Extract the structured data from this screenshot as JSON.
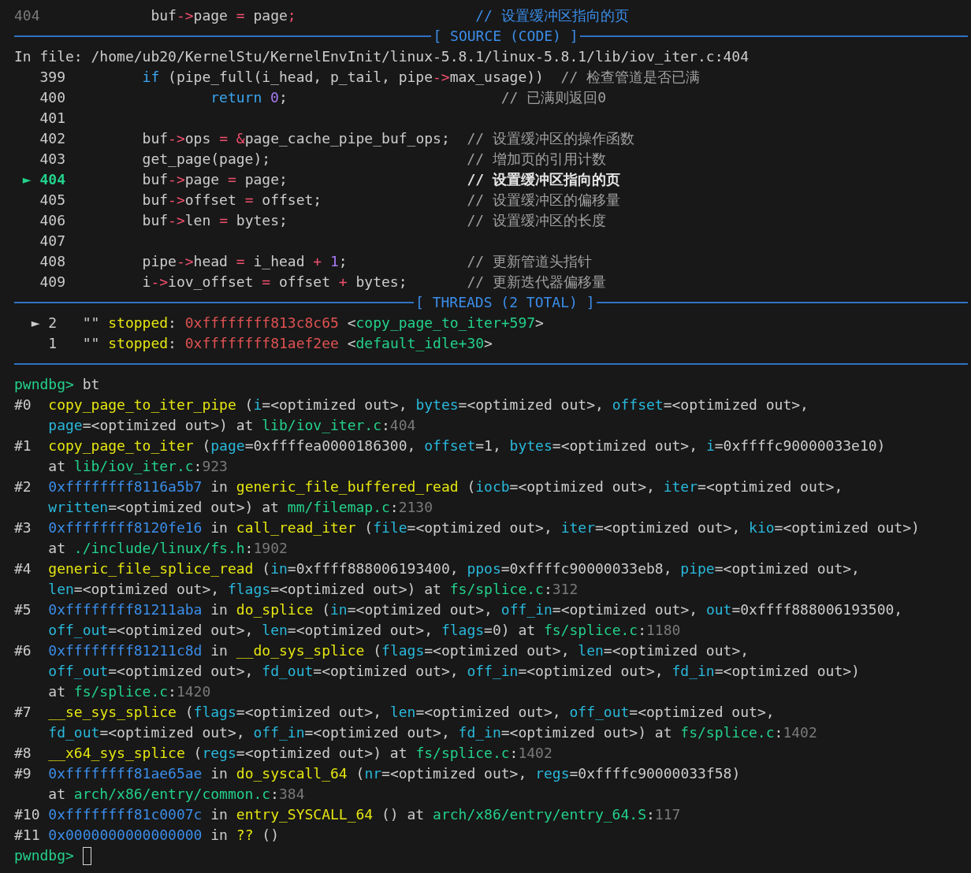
{
  "lines": [
    {
      "kind": "text",
      "segments": [
        {
          "kind": "dim",
          "text": "404"
        },
        "             buf",
        {
          "kind": "op",
          "text": "->"
        },
        "page ",
        {
          "kind": "op",
          "text": "="
        },
        " page",
        {
          "kind": "op",
          "text": ";                     "
        },
        {
          "kind": "heading",
          "text": "// 设置缓冲区指向的页"
        }
      ]
    },
    {
      "kind": "divider",
      "label": "[ SOURCE (CODE) ]"
    },
    {
      "kind": "text",
      "segments": [
        "In file: /home/ub20/KernelStu/KernelEnvInit/linux-5.8.1/linux-5.8.1/lib/iov_iter.c:404"
      ]
    },
    {
      "kind": "text",
      "segments": [
        "   399         ",
        {
          "kind": "kw",
          "text": "if"
        },
        " (pipe_full(i_head, p_tail, pipe",
        {
          "kind": "op",
          "text": "->"
        },
        "max_usage))  ",
        {
          "kind": "comment",
          "text": "// 检查管道是否已满"
        }
      ]
    },
    {
      "kind": "text",
      "segments": [
        "   400                 ",
        {
          "kind": "kw",
          "text": "return "
        },
        {
          "kind": "num",
          "text": "0"
        },
        ";                         ",
        {
          "kind": "comment",
          "text": "// 已满则返回0"
        }
      ]
    },
    {
      "kind": "text",
      "segments": [
        "   401"
      ]
    },
    {
      "kind": "text",
      "segments": [
        "   402         buf",
        {
          "kind": "op",
          "text": "->"
        },
        "ops ",
        {
          "kind": "op",
          "text": "= "
        },
        {
          "kind": "op",
          "text": "&"
        },
        "page_cache_pipe_buf_ops;  ",
        {
          "kind": "comment",
          "text": "// 设置缓冲区的操作函数"
        }
      ]
    },
    {
      "kind": "text",
      "segments": [
        "   403         get_page(page);                       ",
        {
          "kind": "comment",
          "text": "// 增加页的引用计数"
        }
      ]
    },
    {
      "kind": "text",
      "segments": [
        {
          "kind": "current",
          "text": " ► 404"
        },
        "         buf",
        {
          "kind": "op",
          "text": "->"
        },
        "page ",
        {
          "kind": "op",
          "text": "="
        },
        " page;                     ",
        {
          "kind": "strong",
          "text": "// 设置缓冲区指向的页"
        }
      ]
    },
    {
      "kind": "text",
      "segments": [
        "   405         buf",
        {
          "kind": "op",
          "text": "->"
        },
        "offset ",
        {
          "kind": "op",
          "text": "="
        },
        " offset;                 ",
        {
          "kind": "comment",
          "text": "// 设置缓冲区的偏移量"
        }
      ]
    },
    {
      "kind": "text",
      "segments": [
        "   406         buf",
        {
          "kind": "op",
          "text": "->"
        },
        "len ",
        {
          "kind": "op",
          "text": "="
        },
        " bytes;                     ",
        {
          "kind": "comment",
          "text": "// 设置缓冲区的长度"
        }
      ]
    },
    {
      "kind": "text",
      "segments": [
        "   407"
      ]
    },
    {
      "kind": "text",
      "segments": [
        "   408         pipe",
        {
          "kind": "op",
          "text": "->"
        },
        "head ",
        {
          "kind": "op",
          "text": "="
        },
        " i_head ",
        {
          "kind": "op",
          "text": "+ "
        },
        {
          "kind": "num",
          "text": "1"
        },
        ";              ",
        {
          "kind": "comment",
          "text": "// 更新管道头指针"
        }
      ]
    },
    {
      "kind": "text",
      "segments": [
        "   409         i",
        {
          "kind": "op",
          "text": "->"
        },
        "iov_offset ",
        {
          "kind": "op",
          "text": "="
        },
        " offset ",
        {
          "kind": "op",
          "text": "+"
        },
        " bytes;       ",
        {
          "kind": "comment",
          "text": "// 更新迭代器偏移量"
        }
      ]
    },
    {
      "kind": "divider",
      "label": "[ THREADS (2 TOTAL) ]"
    },
    {
      "kind": "text",
      "segments": [
        "  ► 2   \"\" ",
        {
          "kind": "status",
          "text": "stopped"
        },
        ": ",
        {
          "kind": "red",
          "text": "0xffffffff813c8c65"
        },
        " <",
        {
          "kind": "symbol",
          "text": "copy_page_to_iter+597"
        },
        ">"
      ]
    },
    {
      "kind": "text",
      "segments": [
        "    1   \"\" ",
        {
          "kind": "status",
          "text": "stopped"
        },
        ": ",
        {
          "kind": "red",
          "text": "0xffffffff81aef2ee"
        },
        " <",
        {
          "kind": "symbol",
          "text": "default_idle+30"
        },
        ">"
      ]
    },
    {
      "kind": "divider"
    },
    {
      "kind": "text",
      "segments": [
        {
          "kind": "prompt",
          "text": "pwndbg>"
        },
        " bt"
      ]
    },
    {
      "kind": "text",
      "segments": [
        "#0  ",
        {
          "kind": "func",
          "text": "copy_page_to_iter_pipe"
        },
        " (",
        {
          "kind": "param",
          "text": "i"
        },
        "=<optimized out>, ",
        {
          "kind": "param",
          "text": "bytes"
        },
        "=<optimized out>, ",
        {
          "kind": "param",
          "text": "offset"
        },
        "=<optimized out>,"
      ]
    },
    {
      "kind": "text",
      "segments": [
        {
          "kind": "param",
          "text": "    page"
        },
        "=<optimized out>) at ",
        {
          "kind": "path",
          "text": "lib/iov_iter.c"
        },
        ":",
        {
          "kind": "dim",
          "text": "404"
        }
      ]
    },
    {
      "kind": "text",
      "segments": [
        "#1  ",
        {
          "kind": "func",
          "text": "copy_page_to_iter"
        },
        " (",
        {
          "kind": "param",
          "text": "page"
        },
        "=0xffffea0000186300, ",
        {
          "kind": "param",
          "text": "offset"
        },
        "=1, ",
        {
          "kind": "param",
          "text": "bytes"
        },
        "=<optimized out>, ",
        {
          "kind": "param",
          "text": "i"
        },
        "=0xffffc90000033e10)"
      ]
    },
    {
      "kind": "text",
      "segments": [
        "    at ",
        {
          "kind": "path",
          "text": "lib/iov_iter.c"
        },
        ":",
        {
          "kind": "dim",
          "text": "923"
        }
      ]
    },
    {
      "kind": "text",
      "segments": [
        "#2  ",
        {
          "kind": "addr",
          "text": "0xffffffff8116a5b7"
        },
        " in ",
        {
          "kind": "func",
          "text": "generic_file_buffered_read"
        },
        " (",
        {
          "kind": "param",
          "text": "iocb"
        },
        "=<optimized out>, ",
        {
          "kind": "param",
          "text": "iter"
        },
        "=<optimized out>,"
      ]
    },
    {
      "kind": "text",
      "segments": [
        {
          "kind": "param",
          "text": "    written"
        },
        "=<optimized out>) at ",
        {
          "kind": "path",
          "text": "mm/filemap.c"
        },
        ":",
        {
          "kind": "dim",
          "text": "2130"
        }
      ]
    },
    {
      "kind": "text",
      "segments": [
        "#3  ",
        {
          "kind": "addr",
          "text": "0xffffffff8120fe16"
        },
        " in ",
        {
          "kind": "func",
          "text": "call_read_iter"
        },
        " (",
        {
          "kind": "param",
          "text": "file"
        },
        "=<optimized out>, ",
        {
          "kind": "param",
          "text": "iter"
        },
        "=<optimized out>, ",
        {
          "kind": "param",
          "text": "kio"
        },
        "=<optimized out>)"
      ]
    },
    {
      "kind": "text",
      "segments": [
        "    at ",
        {
          "kind": "path",
          "text": "./include/linux/fs.h"
        },
        ":",
        {
          "kind": "dim",
          "text": "1902"
        }
      ]
    },
    {
      "kind": "text",
      "segments": [
        "#4  ",
        {
          "kind": "func",
          "text": "generic_file_splice_read"
        },
        " (",
        {
          "kind": "param",
          "text": "in"
        },
        "=0xffff888006193400, ",
        {
          "kind": "param",
          "text": "ppos"
        },
        "=0xffffc90000033eb8, ",
        {
          "kind": "param",
          "text": "pipe"
        },
        "=<optimized out>,"
      ]
    },
    {
      "kind": "text",
      "segments": [
        {
          "kind": "param",
          "text": "    len"
        },
        "=<optimized out>, ",
        {
          "kind": "param",
          "text": "flags"
        },
        "=<optimized out>) at ",
        {
          "kind": "path",
          "text": "fs/splice.c"
        },
        ":",
        {
          "kind": "dim",
          "text": "312"
        }
      ]
    },
    {
      "kind": "text",
      "segments": [
        "#5  ",
        {
          "kind": "addr",
          "text": "0xffffffff81211aba"
        },
        " in ",
        {
          "kind": "func",
          "text": "do_splice"
        },
        " (",
        {
          "kind": "param",
          "text": "in"
        },
        "=<optimized out>, ",
        {
          "kind": "param",
          "text": "off_in"
        },
        "=<optimized out>, ",
        {
          "kind": "param",
          "text": "out"
        },
        "=0xffff888006193500,"
      ]
    },
    {
      "kind": "text",
      "segments": [
        {
          "kind": "param",
          "text": "    off_out"
        },
        "=<optimized out>, ",
        {
          "kind": "param",
          "text": "len"
        },
        "=<optimized out>, ",
        {
          "kind": "param",
          "text": "flags"
        },
        "=0) at ",
        {
          "kind": "path",
          "text": "fs/splice.c"
        },
        ":",
        {
          "kind": "dim",
          "text": "1180"
        }
      ]
    },
    {
      "kind": "text",
      "segments": [
        "#6  ",
        {
          "kind": "addr",
          "text": "0xffffffff81211c8d"
        },
        " in ",
        {
          "kind": "func",
          "text": "__do_sys_splice"
        },
        " (",
        {
          "kind": "param",
          "text": "flags"
        },
        "=<optimized out>, ",
        {
          "kind": "param",
          "text": "len"
        },
        "=<optimized out>,"
      ]
    },
    {
      "kind": "text",
      "segments": [
        {
          "kind": "param",
          "text": "    off_out"
        },
        "=<optimized out>, ",
        {
          "kind": "param",
          "text": "fd_out"
        },
        "=<optimized out>, ",
        {
          "kind": "param",
          "text": "off_in"
        },
        "=<optimized out>, ",
        {
          "kind": "param",
          "text": "fd_in"
        },
        "=<optimized out>)"
      ]
    },
    {
      "kind": "text",
      "segments": [
        "    at ",
        {
          "kind": "path",
          "text": "fs/splice.c"
        },
        ":",
        {
          "kind": "dim",
          "text": "1420"
        }
      ]
    },
    {
      "kind": "text",
      "segments": [
        "#7  ",
        {
          "kind": "func",
          "text": "__se_sys_splice"
        },
        " (",
        {
          "kind": "param",
          "text": "flags"
        },
        "=<optimized out>, ",
        {
          "kind": "param",
          "text": "len"
        },
        "=<optimized out>, ",
        {
          "kind": "param",
          "text": "off_out"
        },
        "=<optimized out>,"
      ]
    },
    {
      "kind": "text",
      "segments": [
        {
          "kind": "param",
          "text": "    fd_out"
        },
        "=<optimized out>, ",
        {
          "kind": "param",
          "text": "off_in"
        },
        "=<optimized out>, ",
        {
          "kind": "param",
          "text": "fd_in"
        },
        "=<optimized out>) at ",
        {
          "kind": "path",
          "text": "fs/splice.c"
        },
        ":",
        {
          "kind": "dim",
          "text": "1402"
        }
      ]
    },
    {
      "kind": "text",
      "segments": [
        "#8  ",
        {
          "kind": "func",
          "text": "__x64_sys_splice"
        },
        " (",
        {
          "kind": "param",
          "text": "regs"
        },
        "=<optimized out>) at ",
        {
          "kind": "path",
          "text": "fs/splice.c"
        },
        ":",
        {
          "kind": "dim",
          "text": "1402"
        }
      ]
    },
    {
      "kind": "text",
      "segments": [
        "#9  ",
        {
          "kind": "addr",
          "text": "0xffffffff81ae65ae"
        },
        " in ",
        {
          "kind": "func",
          "text": "do_syscall_64"
        },
        " (",
        {
          "kind": "param",
          "text": "nr"
        },
        "=<optimized out>, ",
        {
          "kind": "param",
          "text": "regs"
        },
        "=0xffffc90000033f58)"
      ]
    },
    {
      "kind": "text",
      "segments": [
        "    at ",
        {
          "kind": "path",
          "text": "arch/x86/entry/common.c"
        },
        ":",
        {
          "kind": "dim",
          "text": "384"
        }
      ]
    },
    {
      "kind": "text",
      "segments": [
        "#10 ",
        {
          "kind": "addr",
          "text": "0xffffffff81c0007c"
        },
        " in ",
        {
          "kind": "func",
          "text": "entry_SYSCALL_64"
        },
        " () at ",
        {
          "kind": "path",
          "text": "arch/x86/entry/entry_64.S"
        },
        ":",
        {
          "kind": "dim",
          "text": "117"
        }
      ]
    },
    {
      "kind": "text",
      "segments": [
        "#11 ",
        {
          "kind": "addr",
          "text": "0x0000000000000000"
        },
        " in ",
        {
          "kind": "func",
          "text": "??"
        },
        " ()"
      ]
    },
    {
      "kind": "text",
      "segments": [
        {
          "kind": "prompt",
          "text": "pwndbg> "
        }
      ],
      "cursor": true
    }
  ]
}
